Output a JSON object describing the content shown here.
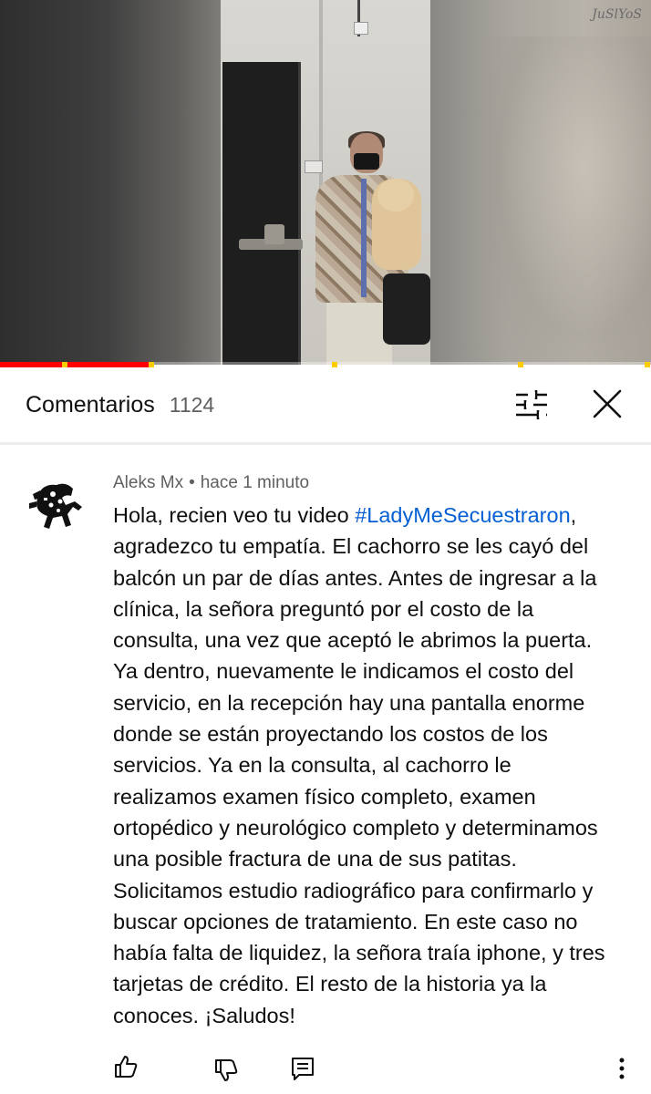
{
  "video": {
    "watermark": "JuSlYoS",
    "progress_fraction": 0.23,
    "ad_markers_fraction": [
      0.095,
      0.228,
      0.51,
      0.795,
      0.99
    ]
  },
  "comments_header": {
    "title": "Comentarios",
    "count": "1124",
    "icons": [
      "sort-icon",
      "close-icon"
    ]
  },
  "comment": {
    "author": "Aleks Mx",
    "separator": "•",
    "time": "hace 1 minuto",
    "lines": [
      {
        "pre": "Hola, recien veo tu video ",
        "tag": "#LadyMeSecuestraron",
        "post": ","
      },
      {
        "pre": "agradezco tu empatía.  El cachorro se les cayó del"
      },
      {
        "pre": "balcón un par de días antes. Antes de ingresar a la"
      },
      {
        "pre": "clínica, la señora preguntó por el costo de la"
      },
      {
        "pre": "consulta, una vez que aceptó le abrimos la puerta."
      },
      {
        "pre": "Ya dentro, nuevamente le indicamos el costo del"
      },
      {
        "pre": "servicio, en la recepción hay una pantalla enorme"
      },
      {
        "pre": "donde se están proyectando los costos de los"
      },
      {
        "pre": "servicios. Ya en la consulta, al cachorro le"
      },
      {
        "pre": "realizamos examen físico completo, examen"
      },
      {
        "pre": "ortopédico y neurológico completo y determinamos"
      },
      {
        "pre": "una posible fractura de una de sus patitas."
      },
      {
        "pre": "Solicitamos estudio radiográfico para confirmarlo y"
      },
      {
        "pre": "buscar opciones de tratamiento. En este caso no"
      },
      {
        "pre": "había falta de liquidez, la señora traía iphone, y tres"
      },
      {
        "pre": "tarjetas de crédito. El resto de la historia ya la"
      },
      {
        "pre": "conoces. ¡Saludos!"
      }
    ],
    "actions": [
      "like-icon",
      "dislike-icon",
      "reply-icon",
      "more-options-icon"
    ]
  },
  "colors": {
    "progress": "#ff0000",
    "ad_marker": "#ffcc00",
    "hashtag": "#065fd4",
    "secondary_text": "#606060"
  }
}
